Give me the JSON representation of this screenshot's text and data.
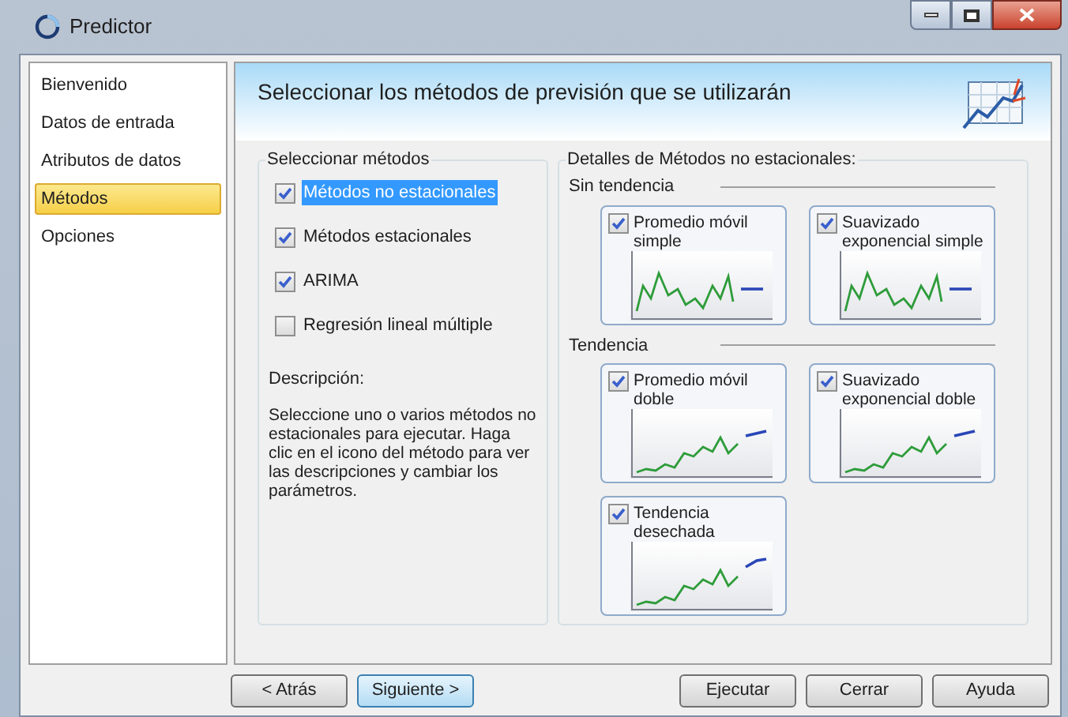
{
  "window": {
    "title": "Predictor"
  },
  "sidebar": {
    "items": [
      {
        "label": "Bienvenido",
        "selected": false
      },
      {
        "label": "Datos de entrada",
        "selected": false
      },
      {
        "label": "Atributos de datos",
        "selected": false
      },
      {
        "label": "Métodos",
        "selected": true
      },
      {
        "label": "Opciones",
        "selected": false
      }
    ]
  },
  "header": {
    "title": "Seleccionar los métodos de previsión que se utilizarán"
  },
  "methods_group": {
    "title": "Seleccionar métodos",
    "options": [
      {
        "label": "Métodos no estacionales",
        "checked": true,
        "selected": true
      },
      {
        "label": "Métodos estacionales",
        "checked": true,
        "selected": false
      },
      {
        "label": "ARIMA",
        "checked": true,
        "selected": false
      },
      {
        "label": "Regresión lineal múltiple",
        "checked": false,
        "selected": false
      }
    ]
  },
  "description": {
    "label": "Descripción:",
    "text": "Seleccione uno o varios métodos no estacionales para ejecutar. Haga clic en el icono del método para ver las descripciones y cambiar los parámetros."
  },
  "details": {
    "title": "Detalles de Métodos no estacionales:",
    "sections": [
      {
        "title": "Sin tendencia",
        "methods": [
          {
            "label": "Promedio móvil simple",
            "checked": true,
            "kind": "flat"
          },
          {
            "label": "Suavizado exponencial simple",
            "checked": true,
            "kind": "flat"
          }
        ]
      },
      {
        "title": "Tendencia",
        "methods": [
          {
            "label": "Promedio móvil doble",
            "checked": true,
            "kind": "trend"
          },
          {
            "label": "Suavizado exponencial doble",
            "checked": true,
            "kind": "trend"
          },
          {
            "label": "Tendencia desechada",
            "checked": true,
            "kind": "damped"
          }
        ]
      }
    ]
  },
  "buttons": [
    {
      "label": "< Atrás",
      "default": false
    },
    {
      "label": "Siguiente >",
      "default": true
    },
    {
      "label": "Ejecutar",
      "default": false
    },
    {
      "label": "Cerrar",
      "default": false
    },
    {
      "label": "Ayuda",
      "default": false
    }
  ]
}
